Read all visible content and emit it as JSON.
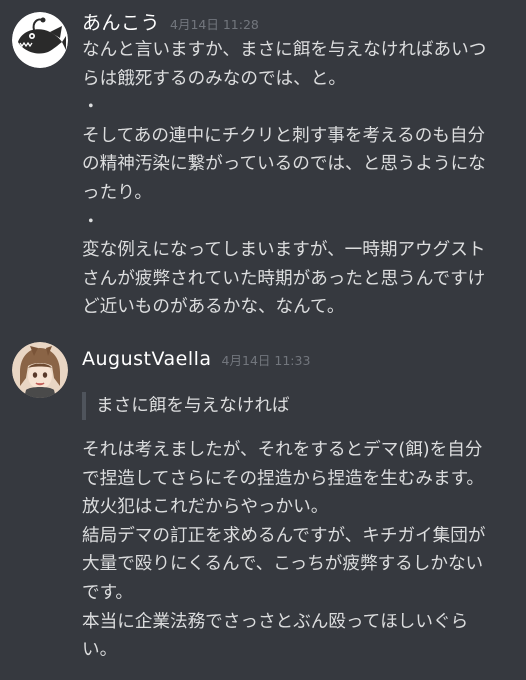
{
  "messages": [
    {
      "author": "あんこう",
      "timestamp": "4月14日 11:28",
      "avatar_icon": "anglerfish-avatar-icon",
      "lines": [
        "なんと言いますか、まさに餌を与えなければあいつ",
        "らは餓死するのみなのでは、と。",
        "・",
        "そしてあの連中にチクリと刺す事を考えるのも自分",
        "の精神汚染に繋がっているのでは、と思うようにな",
        "ったり。",
        "・",
        "変な例えになってしまいますが、一時期アウグスト",
        "さんが疲弊されていた時期があったと思うんですけ",
        "ど近いものがあるかな、なんて。"
      ]
    },
    {
      "author": "AugustVaella",
      "timestamp": "4月14日 11:33",
      "avatar_icon": "anime-character-avatar-icon",
      "quote": "まさに餌を与えなければ",
      "lines": [
        "それは考えましたが、それをするとデマ(餌)を自分",
        "で捏造してさらにその捏造から捏造を生むみます。",
        "放火犯はこれだからやっかい。",
        "結局デマの訂正を求めるんですが、キチガイ集団が",
        "大量で殴りにくるんで、こっちが疲弊するしかない",
        "です。",
        "本当に企業法務でさっさとぶん殴ってほしいぐら",
        "い。"
      ]
    }
  ],
  "colors": {
    "background": "#36393f",
    "username": "#ffffff",
    "timestamp": "#72767d",
    "text": "#dcddde",
    "quote_bar": "#4f545c"
  }
}
